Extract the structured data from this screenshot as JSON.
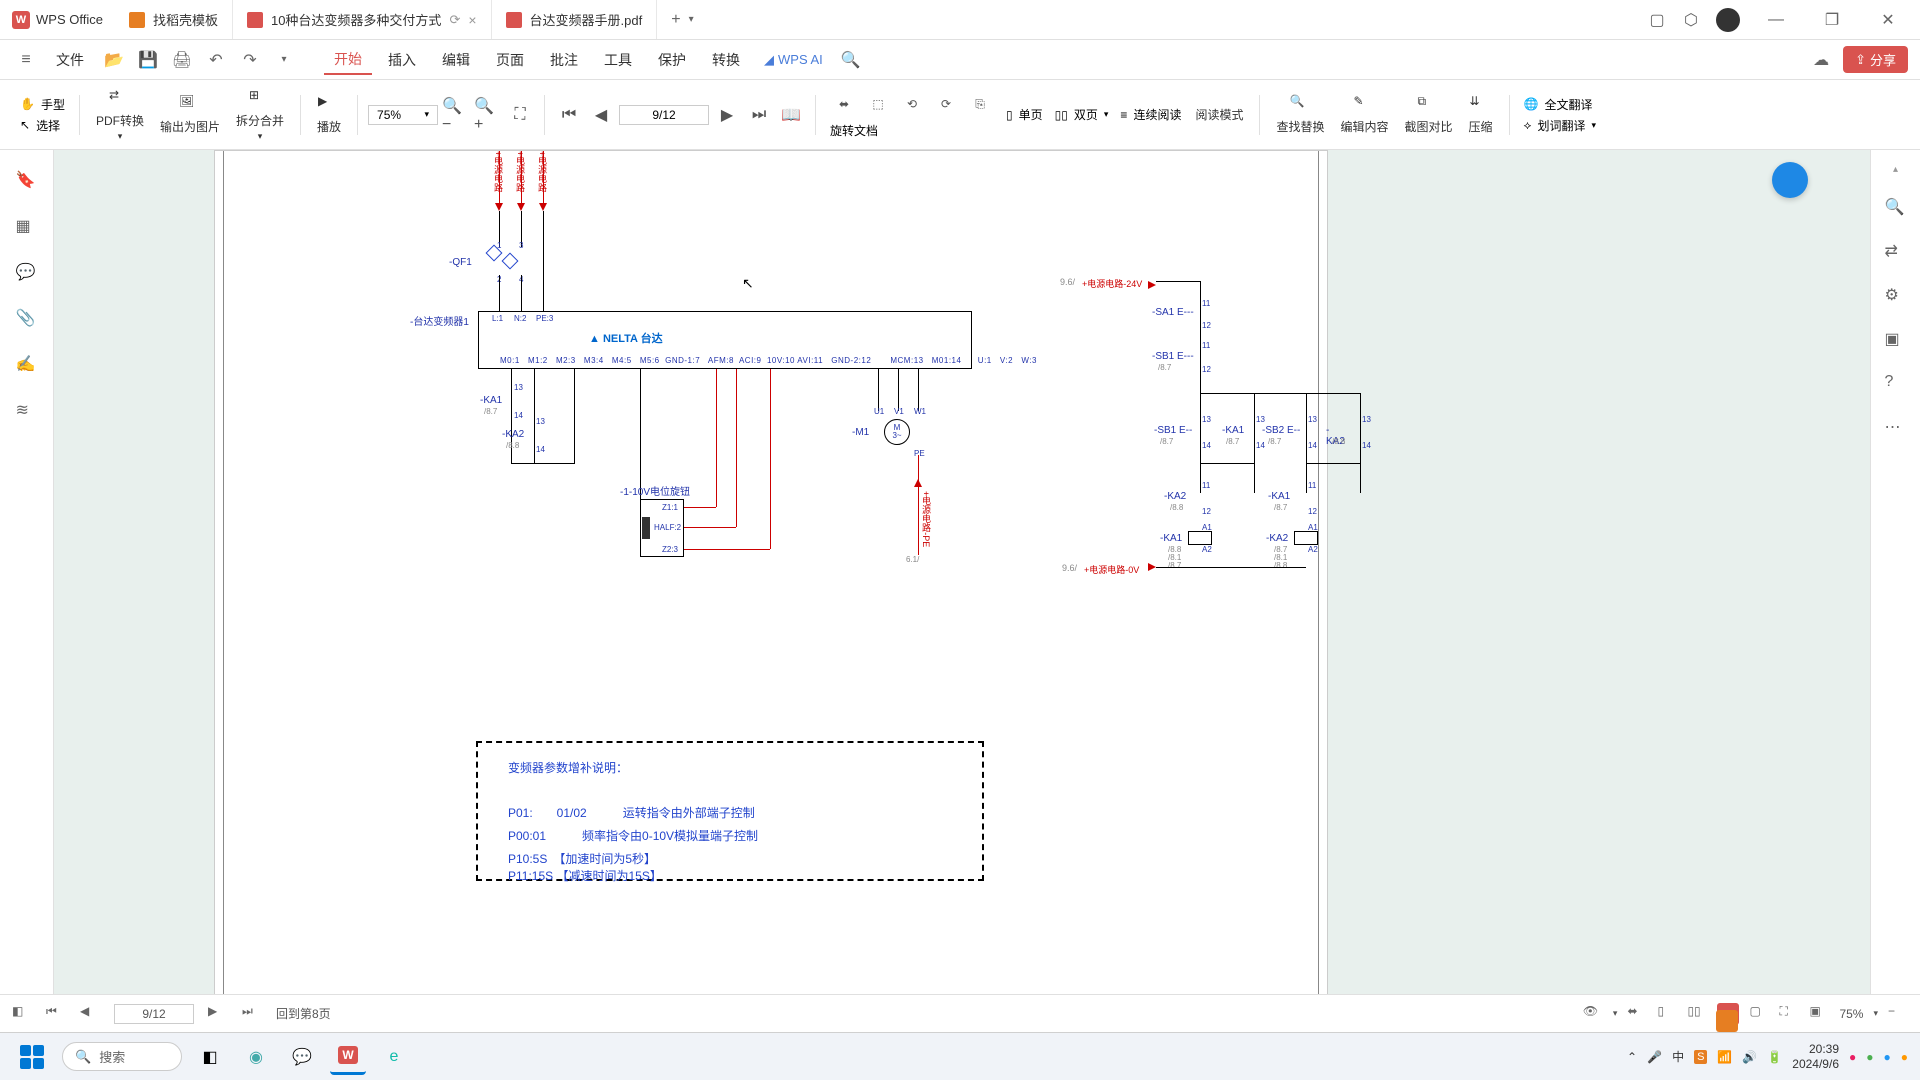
{
  "app": {
    "name": "WPS Office"
  },
  "tabs": [
    {
      "label": "找稻壳模板",
      "icon": "orange"
    },
    {
      "label": "10种台达变频器多种交付方式",
      "icon": "red",
      "active": true,
      "closable": true
    },
    {
      "label": "台达变频器手册.pdf",
      "icon": "red"
    }
  ],
  "menu": {
    "file": "文件",
    "items": [
      "开始",
      "插入",
      "编辑",
      "页面",
      "批注",
      "工具",
      "保护",
      "转换"
    ],
    "active": "开始",
    "wps_ai": "WPS AI",
    "share": "分享"
  },
  "toolbar": {
    "hand": "手型",
    "select": "选择",
    "pdf_convert": "PDF转换",
    "export_img": "输出为图片",
    "split_merge": "拆分合并",
    "play": "播放",
    "zoom": "75%",
    "page_indicator": "9/12",
    "rotate": "旋转文档",
    "single_page": "单页",
    "double_page": "双页",
    "continuous": "连续阅读",
    "read_mode": "阅读模式",
    "find_replace": "查找替换",
    "edit_content": "编辑内容",
    "screenshot_compare": "截图对比",
    "compress": "压缩",
    "full_translate": "全文翻译",
    "word_translate": "划词翻译"
  },
  "statusbar": {
    "page": "9/12",
    "back_to": "回到第8页",
    "zoom": "75%"
  },
  "taskbar": {
    "search": "搜索",
    "time": "20:39",
    "date": "2024/9/6"
  },
  "schematic": {
    "power_labels": [
      "+电源电路",
      "+电源电路",
      "+电源电路"
    ],
    "qf1": "-QF1",
    "inverter_label": "-台达变频器1",
    "brand": "NELTA 台达",
    "top_terminals": [
      "L:1",
      "N:2",
      "PE:3"
    ],
    "bottom_terminals": [
      "M0:1",
      "M1:2",
      "M2:3",
      "M3:4",
      "M4:5",
      "M5:6",
      "GND-1:7",
      "AFM:8",
      "ACI:9",
      "10V:10",
      "AVI:11",
      "GND-2:12",
      "MCM:13",
      "M01:14",
      "U:1",
      "V:2",
      "W:3"
    ],
    "ka1": "-KA1",
    "ka2": "-KA2",
    "ka1_ref": "/8.7",
    "ka2_ref": "/8.8",
    "pot_label": "-1-10V电位旋钮",
    "pot_terminals": [
      "Z1:1",
      "HALF:2",
      "Z2:3"
    ],
    "motor": "-M1",
    "motor_m": "M",
    "motor_3": "3~",
    "motor_uvw": [
      "U1",
      "V1",
      "W1"
    ],
    "motor_pe": "PE",
    "power_pe": "+电源电路-PE",
    "power_pe_ref": "6.1/",
    "right_24v": "+电源电路-24V",
    "right_24v_ref": "9.6/",
    "right_0v": "+电源电路-0V",
    "right_0v_ref": "9.6/",
    "sa1": "-SA1 E---",
    "sb1": "-SB1 E---",
    "sb1_ref": "/8.7",
    "sb1_2": "-SB1 E--",
    "sb1_2_ref": "/8.7",
    "sb2": "-SB2 E--",
    "sb2_ref": "/8.7",
    "ka1_r": "-KA1",
    "ka1_r_ref": "/8.7",
    "ka2_r": "-KA2",
    "ka2_r_ref": "/8.8",
    "ka1_coil": "-KA1",
    "ka1_coil_refs": [
      "/8.8",
      "/8.1",
      "/8.7"
    ],
    "ka2_coil": "-KA2",
    "ka2_coil_refs": [
      "/8.7",
      "/8.1",
      "/8.8"
    ],
    "terminals_11_14": [
      "11",
      "12",
      "13",
      "14"
    ],
    "a1a2": [
      "A1",
      "A2"
    ],
    "param_title": "变频器参数增补说明：",
    "param_lines": [
      "P01:　　01/02　　　运转指令由外部端子控制",
      "P00:01　　　频率指令由0-10V模拟量端子控制",
      "P10:5S　【加速时间为5秒】",
      "P11:15S 【减速时间为15S】"
    ]
  }
}
